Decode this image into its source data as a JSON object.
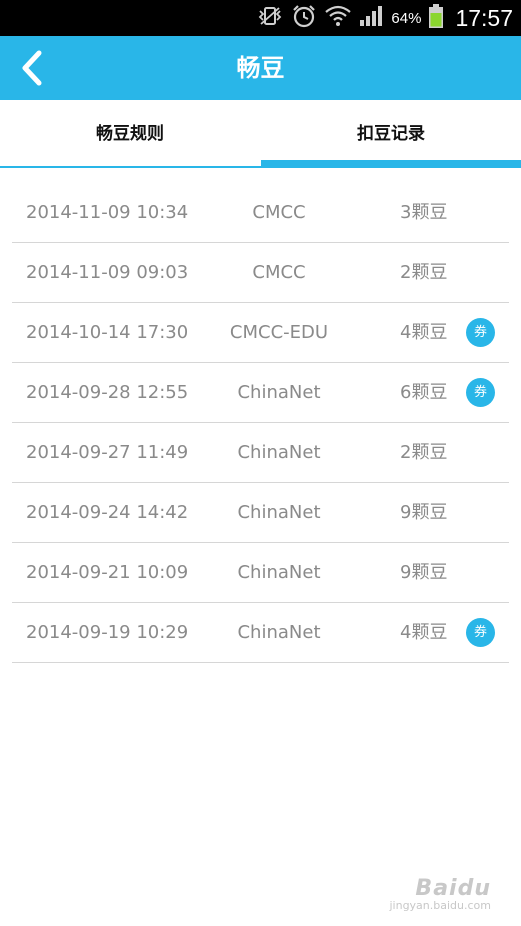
{
  "status_bar": {
    "battery_percent": "64%",
    "time": "17:57"
  },
  "header": {
    "title": "畅豆"
  },
  "tabs": [
    {
      "label": "畅豆规则",
      "selected": false
    },
    {
      "label": "扣豆记录",
      "selected": true
    }
  ],
  "records": [
    {
      "datetime": "2014-11-09 10:34",
      "network": "CMCC",
      "beans": "3颗豆",
      "coupon": ""
    },
    {
      "datetime": "2014-11-09 09:03",
      "network": "CMCC",
      "beans": "2颗豆",
      "coupon": ""
    },
    {
      "datetime": "2014-10-14 17:30",
      "network": "CMCC-EDU",
      "beans": "4颗豆",
      "coupon": "券"
    },
    {
      "datetime": "2014-09-28 12:55",
      "network": "ChinaNet",
      "beans": "6颗豆",
      "coupon": "券"
    },
    {
      "datetime": "2014-09-27 11:49",
      "network": "ChinaNet",
      "beans": "2颗豆",
      "coupon": ""
    },
    {
      "datetime": "2014-09-24 14:42",
      "network": "ChinaNet",
      "beans": "9颗豆",
      "coupon": ""
    },
    {
      "datetime": "2014-09-21 10:09",
      "network": "ChinaNet",
      "beans": "9颗豆",
      "coupon": ""
    },
    {
      "datetime": "2014-09-19 10:29",
      "network": "ChinaNet",
      "beans": "4颗豆",
      "coupon": "券"
    }
  ],
  "watermark": {
    "logo": "Baidu",
    "sub": "jingyan.baidu.com"
  },
  "colors": {
    "accent": "#29b6e8",
    "status_bar": "#000000",
    "row_text": "#8a8a8a",
    "divider": "#d6d6d6",
    "battery": "#8bd62f"
  },
  "icons": {
    "status": [
      "vibrate-icon",
      "alarm-icon",
      "wifi-icon",
      "signal-icon",
      "battery-icon"
    ],
    "back": "chevron-left-icon"
  }
}
